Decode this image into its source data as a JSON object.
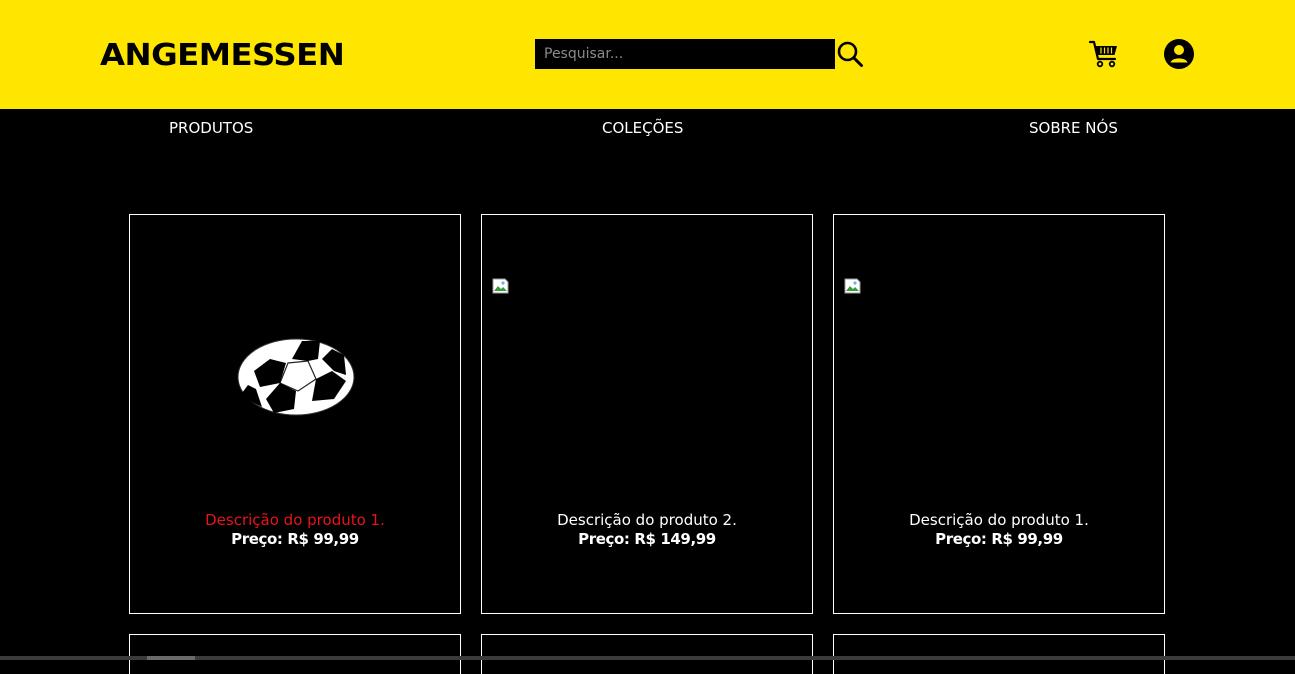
{
  "header": {
    "logo": "ANGEMESSEN",
    "search": {
      "placeholder": "Pesquisar...",
      "value": ""
    },
    "icons": {
      "search": "search-icon",
      "cart": "cart-icon",
      "account": "account-icon"
    }
  },
  "nav": [
    {
      "label": "PRODUTOS"
    },
    {
      "label": "COLEÇÕES"
    },
    {
      "label": "SOBRE NÓS"
    }
  ],
  "products": [
    {
      "description": "Descrição do produto 1.",
      "price": "Preço: R$ 99,99",
      "image": "soccer-ball-image",
      "highlighted": true
    },
    {
      "description": "Descrição do produto 2.",
      "price": "Preço: R$ 149,99",
      "image": "broken-image",
      "highlighted": false
    },
    {
      "description": "Descrição do produto 1.",
      "price": "Preço: R$ 99,99",
      "image": "broken-image",
      "highlighted": false
    }
  ],
  "colors": {
    "header_bg": "#ffe600",
    "page_bg": "#000000",
    "highlight_text": "#e8141b",
    "text": "#ffffff"
  }
}
